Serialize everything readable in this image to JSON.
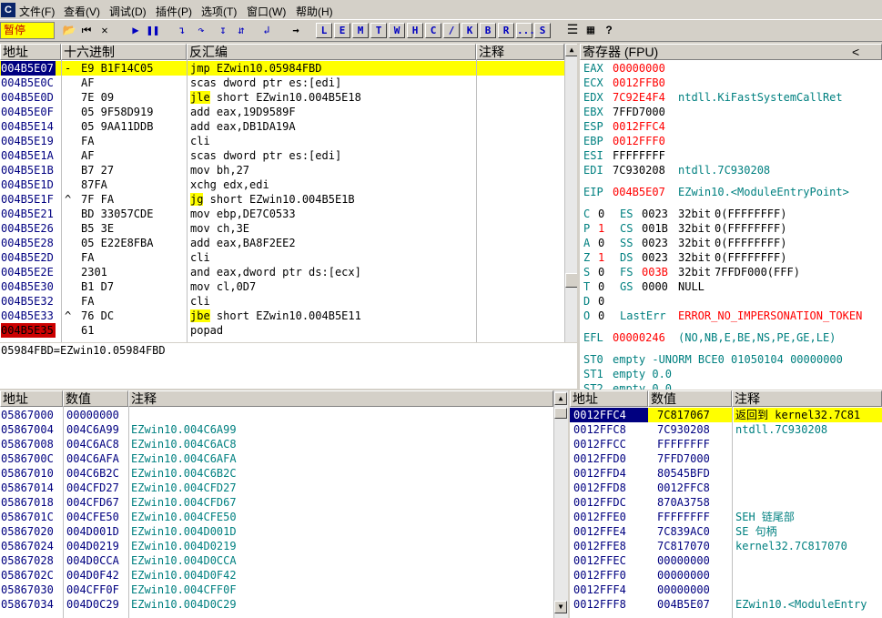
{
  "app": {
    "icon": "C"
  },
  "menu": [
    "文件(F)",
    "查看(V)",
    "调试(D)",
    "插件(P)",
    "选项(T)",
    "窗口(W)",
    "帮助(H)"
  ],
  "toolbar": {
    "status": "暂停",
    "letters": [
      "L",
      "E",
      "M",
      "T",
      "W",
      "H",
      "C",
      "/",
      "K",
      "B",
      "R",
      "...",
      "S"
    ]
  },
  "disasm": {
    "headers": {
      "addr": "地址",
      "hex": "十六进制",
      "dis": "反汇编",
      "comment": "注释"
    },
    "rows": [
      {
        "addr": "004B5E07",
        "mark": "-",
        "hex": "E9 B1F14C05",
        "op": "jmp",
        "rest": " EZwin10.05984FBD",
        "hl_op": true,
        "sel": true
      },
      {
        "addr": "004B5E0C",
        "mark": "",
        "hex": "AF",
        "op": "",
        "rest": "scas dword ptr es:[edi]"
      },
      {
        "addr": "004B5E0D",
        "mark": "",
        "hex": "7E 09",
        "op": "jle",
        "rest": " short EZwin10.004B5E18",
        "hl_op": true
      },
      {
        "addr": "004B5E0F",
        "mark": "",
        "hex": "05 9F58D919",
        "op": "",
        "rest": "add eax,19D9589F"
      },
      {
        "addr": "004B5E14",
        "mark": "",
        "hex": "05 9AA11DDB",
        "op": "",
        "rest": "add eax,DB1DA19A"
      },
      {
        "addr": "004B5E19",
        "mark": "",
        "hex": "FA",
        "op": "",
        "rest": "cli"
      },
      {
        "addr": "004B5E1A",
        "mark": "",
        "hex": "AF",
        "op": "",
        "rest": "scas dword ptr es:[edi]"
      },
      {
        "addr": "004B5E1B",
        "mark": "",
        "hex": "B7 27",
        "op": "",
        "rest": "mov bh,27"
      },
      {
        "addr": "004B5E1D",
        "mark": "",
        "hex": "87FA",
        "op": "",
        "rest": "xchg edx,edi"
      },
      {
        "addr": "004B5E1F",
        "mark": "^",
        "hex": "7F FA",
        "op": "jg",
        "rest": " short EZwin10.004B5E1B",
        "hl_op": true
      },
      {
        "addr": "004B5E21",
        "mark": "",
        "hex": "BD 33057CDE",
        "op": "",
        "rest": "mov ebp,DE7C0533"
      },
      {
        "addr": "004B5E26",
        "mark": "",
        "hex": "B5 3E",
        "op": "",
        "rest": "mov ch,3E"
      },
      {
        "addr": "004B5E28",
        "mark": "",
        "hex": "05 E22E8FBA",
        "op": "",
        "rest": "add eax,BA8F2EE2"
      },
      {
        "addr": "004B5E2D",
        "mark": "",
        "hex": "FA",
        "op": "",
        "rest": "cli"
      },
      {
        "addr": "004B5E2E",
        "mark": "",
        "hex": "2301",
        "op": "",
        "rest": "and eax,dword ptr ds:[ecx]"
      },
      {
        "addr": "004B5E30",
        "mark": "",
        "hex": "B1 D7",
        "op": "",
        "rest": "mov cl,0D7"
      },
      {
        "addr": "004B5E32",
        "mark": "",
        "hex": "FA",
        "op": "",
        "rest": "cli"
      },
      {
        "addr": "004B5E33",
        "mark": "^",
        "hex": "76 DC",
        "op": "jbe",
        "rest": " short EZwin10.004B5E11",
        "hl_op": true
      },
      {
        "addr": "004B5E35",
        "mark": "",
        "hex": "61",
        "op": "",
        "rest": "popad",
        "bp": true
      }
    ]
  },
  "info": {
    "line": "05984FBD=EZwin10.05984FBD"
  },
  "registers": {
    "title": "寄存器 (FPU)",
    "collapse": "<",
    "gp": [
      {
        "n": "EAX",
        "v": "00000000",
        "red": true,
        "c": ""
      },
      {
        "n": "ECX",
        "v": "0012FFB0",
        "red": true,
        "c": ""
      },
      {
        "n": "EDX",
        "v": "7C92E4F4",
        "red": true,
        "c": "ntdll.KiFastSystemCallRet"
      },
      {
        "n": "EBX",
        "v": "7FFD7000",
        "red": false,
        "c": ""
      },
      {
        "n": "ESP",
        "v": "0012FFC4",
        "red": true,
        "c": ""
      },
      {
        "n": "EBP",
        "v": "0012FFF0",
        "red": true,
        "c": ""
      },
      {
        "n": "ESI",
        "v": "FFFFFFFF",
        "red": false,
        "c": ""
      },
      {
        "n": "EDI",
        "v": "7C930208",
        "red": false,
        "c": "ntdll.7C930208"
      }
    ],
    "eip": {
      "n": "EIP",
      "v": "004B5E07",
      "c": "EZwin10.<ModuleEntryPoint>"
    },
    "flags": [
      {
        "f": "C",
        "b": "0",
        "s": "ES",
        "sv": "0023",
        "w": "32bit",
        "d": "0(FFFFFFFF)",
        "bred": false,
        "svred": false
      },
      {
        "f": "P",
        "b": "1",
        "s": "CS",
        "sv": "001B",
        "w": "32bit",
        "d": "0(FFFFFFFF)",
        "bred": true,
        "svred": false
      },
      {
        "f": "A",
        "b": "0",
        "s": "SS",
        "sv": "0023",
        "w": "32bit",
        "d": "0(FFFFFFFF)",
        "bred": false,
        "svred": false
      },
      {
        "f": "Z",
        "b": "1",
        "s": "DS",
        "sv": "0023",
        "w": "32bit",
        "d": "0(FFFFFFFF)",
        "bred": true,
        "svred": false
      },
      {
        "f": "S",
        "b": "0",
        "s": "FS",
        "sv": "003B",
        "w": "32bit",
        "d": "7FFDF000(FFF)",
        "bred": false,
        "svred": true
      },
      {
        "f": "T",
        "b": "0",
        "s": "GS",
        "sv": "0000",
        "w": "NULL",
        "d": "",
        "bred": false,
        "svred": false
      },
      {
        "f": "D",
        "b": "0",
        "s": "",
        "sv": "",
        "w": "",
        "d": "",
        "bred": false,
        "svred": false
      },
      {
        "f": "O",
        "b": "0",
        "s": "LastErr",
        "sv": "",
        "w": "",
        "d": "ERROR_NO_IMPERSONATION_TOKEN",
        "bred": false,
        "svred": false
      }
    ],
    "efl": {
      "n": "EFL",
      "v": "00000246",
      "c": "(NO,NB,E,BE,NS,PE,GE,LE)"
    },
    "st": [
      {
        "n": "ST0",
        "v": "empty -UNORM BCE0 01050104 00000000"
      },
      {
        "n": "ST1",
        "v": "empty 0.0"
      },
      {
        "n": "ST2",
        "v": "empty 0.0"
      }
    ]
  },
  "dump": {
    "headers": {
      "addr": "地址",
      "val": "数值",
      "comment": "注释"
    },
    "rows": [
      {
        "a": "05867000",
        "v": "00000000",
        "c": ""
      },
      {
        "a": "05867004",
        "v": "004C6A99",
        "c": "EZwin10.004C6A99"
      },
      {
        "a": "05867008",
        "v": "004C6AC8",
        "c": "EZwin10.004C6AC8"
      },
      {
        "a": "0586700C",
        "v": "004C6AFA",
        "c": "EZwin10.004C6AFA"
      },
      {
        "a": "05867010",
        "v": "004C6B2C",
        "c": "EZwin10.004C6B2C"
      },
      {
        "a": "05867014",
        "v": "004CFD27",
        "c": "EZwin10.004CFD27"
      },
      {
        "a": "05867018",
        "v": "004CFD67",
        "c": "EZwin10.004CFD67"
      },
      {
        "a": "0586701C",
        "v": "004CFE50",
        "c": "EZwin10.004CFE50"
      },
      {
        "a": "05867020",
        "v": "004D001D",
        "c": "EZwin10.004D001D"
      },
      {
        "a": "05867024",
        "v": "004D0219",
        "c": "EZwin10.004D0219"
      },
      {
        "a": "05867028",
        "v": "004D0CCA",
        "c": "EZwin10.004D0CCA"
      },
      {
        "a": "0586702C",
        "v": "004D0F42",
        "c": "EZwin10.004D0F42"
      },
      {
        "a": "05867030",
        "v": "004CFF0F",
        "c": "EZwin10.004CFF0F"
      },
      {
        "a": "05867034",
        "v": "004D0C29",
        "c": "EZwin10.004D0C29"
      }
    ]
  },
  "stack": {
    "headers": {
      "addr": "地址",
      "val": "数值",
      "comment": "注释"
    },
    "rows": [
      {
        "a": "0012FFC4",
        "v": "7C817067",
        "c": "返回到 kernel32.7C81",
        "sel": true
      },
      {
        "a": "0012FFC8",
        "v": "7C930208",
        "c": "ntdll.7C930208"
      },
      {
        "a": "0012FFCC",
        "v": "FFFFFFFF",
        "c": ""
      },
      {
        "a": "0012FFD0",
        "v": "7FFD7000",
        "c": ""
      },
      {
        "a": "0012FFD4",
        "v": "80545BFD",
        "c": ""
      },
      {
        "a": "0012FFD8",
        "v": "0012FFC8",
        "c": ""
      },
      {
        "a": "0012FFDC",
        "v": "870A3758",
        "c": ""
      },
      {
        "a": "0012FFE0",
        "v": "FFFFFFFF",
        "c": "SEH 链尾部"
      },
      {
        "a": "0012FFE4",
        "v": "7C839AC0",
        "c": "SE 句柄"
      },
      {
        "a": "0012FFE8",
        "v": "7C817070",
        "c": "kernel32.7C817070"
      },
      {
        "a": "0012FFEC",
        "v": "00000000",
        "c": ""
      },
      {
        "a": "0012FFF0",
        "v": "00000000",
        "c": ""
      },
      {
        "a": "0012FFF4",
        "v": "00000000",
        "c": ""
      },
      {
        "a": "0012FFF8",
        "v": "004B5E07",
        "c": "EZwin10.<ModuleEntry"
      }
    ]
  },
  "colors": {
    "select": "#000080",
    "highlight": "#ffff00",
    "breakpoint": "#cc0000",
    "reg_changed": "#ff0000",
    "comment": "#008080"
  }
}
